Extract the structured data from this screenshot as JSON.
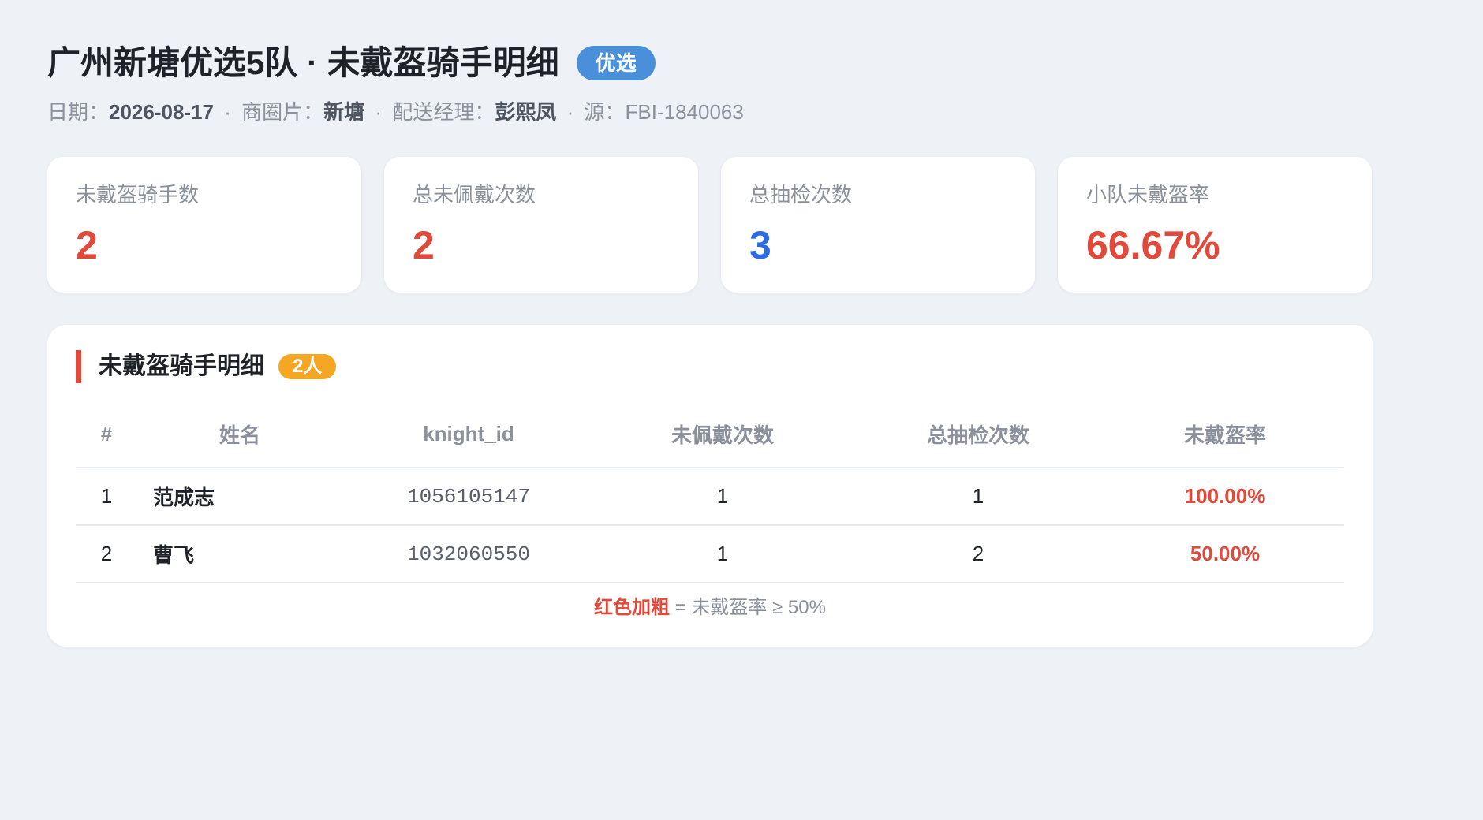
{
  "header": {
    "title": "广州新塘优选5队 · 未戴盔骑手明细",
    "badge": "优选",
    "meta": {
      "date_label": "日期：",
      "date_value": "2026-08-17",
      "area_label": "商圈片：",
      "area_value": "新塘",
      "manager_label": "配送经理：",
      "manager_value": "彭熙凤",
      "source_label": "源：",
      "source_value": "FBI-1840063",
      "separator": "·"
    }
  },
  "stats": [
    {
      "label": "未戴盔骑手数",
      "value": "2",
      "color": "#e04a3b"
    },
    {
      "label": "总未佩戴次数",
      "value": "2",
      "color": "#e04a3b"
    },
    {
      "label": "总抽检次数",
      "value": "3",
      "color": "#2d6be4"
    },
    {
      "label": "小队未戴盔率",
      "value": "66.67%",
      "color": "#e04a3b"
    }
  ],
  "panel": {
    "title": "未戴盔骑手明细",
    "badge": "2人",
    "accent_color": "#e04a3b",
    "columns": [
      "#",
      "姓名",
      "knight_id",
      "未佩戴次数",
      "总抽检次数",
      "未戴盔率"
    ],
    "rows": [
      {
        "idx": "1",
        "name": "范成志",
        "knight_id": "1056105147",
        "missed": "1",
        "total": "1",
        "rate": "100.00%"
      },
      {
        "idx": "2",
        "name": "曹飞",
        "knight_id": "1032060550",
        "missed": "1",
        "total": "2",
        "rate": "50.00%"
      }
    ],
    "note_key": "红色加粗",
    "note_text": " = 未戴盔率 ≥ 50%"
  }
}
